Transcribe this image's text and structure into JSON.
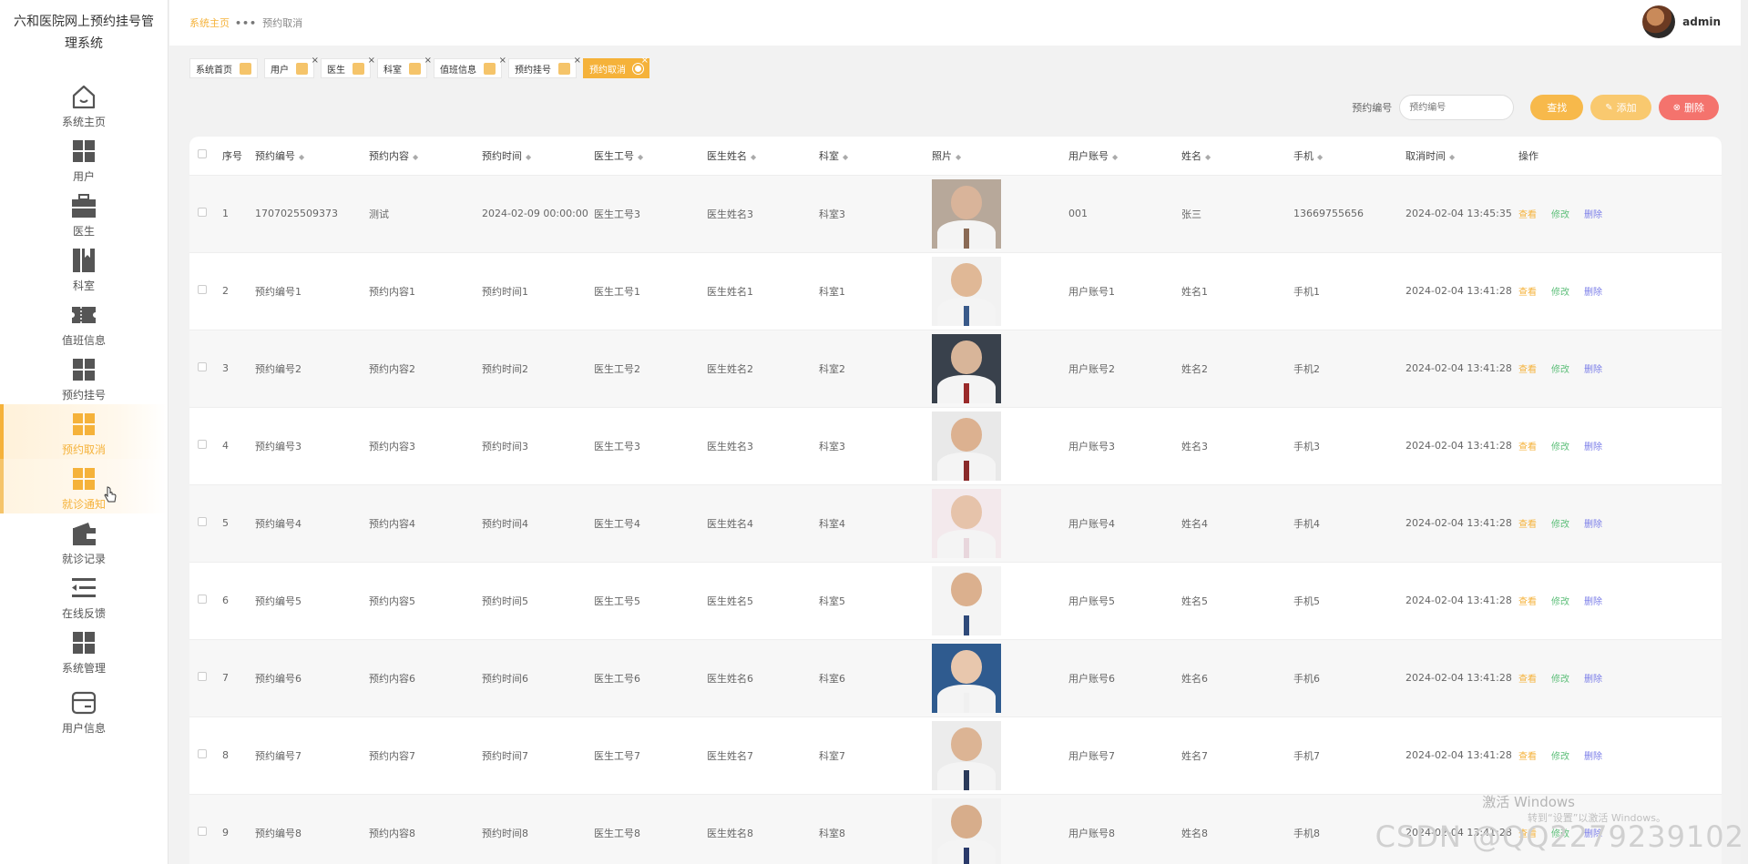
{
  "app": {
    "title": "六和医院网上预约挂号管理系统"
  },
  "sidebar": {
    "items": [
      {
        "label": "系统主页",
        "icon": "home-icon"
      },
      {
        "label": "用户",
        "icon": "grid-icon"
      },
      {
        "label": "医生",
        "icon": "briefcase-icon"
      },
      {
        "label": "科室",
        "icon": "book-icon"
      },
      {
        "label": "值班信息",
        "icon": "ticket-icon"
      },
      {
        "label": "预约挂号",
        "icon": "grid-icon"
      },
      {
        "label": "预约取消",
        "icon": "grid-icon"
      },
      {
        "label": "就诊通知",
        "icon": "grid-icon"
      },
      {
        "label": "就诊记录",
        "icon": "wallet-icon"
      },
      {
        "label": "在线反馈",
        "icon": "list-icon"
      },
      {
        "label": "系统管理",
        "icon": "grid-icon"
      },
      {
        "label": "用户信息",
        "icon": "card-icon"
      }
    ]
  },
  "header": {
    "breadcrumb_home": "系统主页",
    "breadcrumb_sep": "•••",
    "breadcrumb_current": "预约取消",
    "user_name": "admin"
  },
  "tabs": [
    {
      "label": "系统首页"
    },
    {
      "label": "用户"
    },
    {
      "label": "医生"
    },
    {
      "label": "科室"
    },
    {
      "label": "值班信息"
    },
    {
      "label": "预约挂号"
    },
    {
      "label": "预约取消"
    }
  ],
  "search": {
    "label": "预约编号",
    "placeholder": "预约编号",
    "search_btn": "查找",
    "add_btn": "添加",
    "delete_btn": "删除"
  },
  "table": {
    "headers": {
      "index": "序号",
      "appointment_no": "预约编号",
      "content": "预约内容",
      "time": "预约时间",
      "doctor_no": "医生工号",
      "doctor_name": "医生姓名",
      "department": "科室",
      "photo": "照片",
      "account": "用户账号",
      "name": "姓名",
      "phone": "手机",
      "cancel_time": "取消时间",
      "actions": "操作"
    },
    "action_labels": {
      "view": "查看",
      "edit": "修改",
      "delete": "删除"
    },
    "rows": [
      {
        "index": "1",
        "appointment_no": "1707025509373",
        "content": "测试",
        "time": "2024-02-09 00:00:00",
        "doctor_no": "医生工号3",
        "doctor_name": "医生姓名3",
        "department": "科室3",
        "account": "001",
        "name": "张三",
        "phone": "13669755656",
        "cancel_time": "2024-02-04 13:45:35"
      },
      {
        "index": "2",
        "appointment_no": "预约编号1",
        "content": "预约内容1",
        "time": "预约时间1",
        "doctor_no": "医生工号1",
        "doctor_name": "医生姓名1",
        "department": "科室1",
        "account": "用户账号1",
        "name": "姓名1",
        "phone": "手机1",
        "cancel_time": "2024-02-04 13:41:28"
      },
      {
        "index": "3",
        "appointment_no": "预约编号2",
        "content": "预约内容2",
        "time": "预约时间2",
        "doctor_no": "医生工号2",
        "doctor_name": "医生姓名2",
        "department": "科室2",
        "account": "用户账号2",
        "name": "姓名2",
        "phone": "手机2",
        "cancel_time": "2024-02-04 13:41:28"
      },
      {
        "index": "4",
        "appointment_no": "预约编号3",
        "content": "预约内容3",
        "time": "预约时间3",
        "doctor_no": "医生工号3",
        "doctor_name": "医生姓名3",
        "department": "科室3",
        "account": "用户账号3",
        "name": "姓名3",
        "phone": "手机3",
        "cancel_time": "2024-02-04 13:41:28"
      },
      {
        "index": "5",
        "appointment_no": "预约编号4",
        "content": "预约内容4",
        "time": "预约时间4",
        "doctor_no": "医生工号4",
        "doctor_name": "医生姓名4",
        "department": "科室4",
        "account": "用户账号4",
        "name": "姓名4",
        "phone": "手机4",
        "cancel_time": "2024-02-04 13:41:28"
      },
      {
        "index": "6",
        "appointment_no": "预约编号5",
        "content": "预约内容5",
        "time": "预约时间5",
        "doctor_no": "医生工号5",
        "doctor_name": "医生姓名5",
        "department": "科室5",
        "account": "用户账号5",
        "name": "姓名5",
        "phone": "手机5",
        "cancel_time": "2024-02-04 13:41:28"
      },
      {
        "index": "7",
        "appointment_no": "预约编号6",
        "content": "预约内容6",
        "time": "预约时间6",
        "doctor_no": "医生工号6",
        "doctor_name": "医生姓名6",
        "department": "科室6",
        "account": "用户账号6",
        "name": "姓名6",
        "phone": "手机6",
        "cancel_time": "2024-02-04 13:41:28"
      },
      {
        "index": "8",
        "appointment_no": "预约编号7",
        "content": "预约内容7",
        "time": "预约时间7",
        "doctor_no": "医生工号7",
        "doctor_name": "医生姓名7",
        "department": "科室7",
        "account": "用户账号7",
        "name": "姓名7",
        "phone": "手机7",
        "cancel_time": "2024-02-04 13:41:28"
      },
      {
        "index": "9",
        "appointment_no": "预约编号8",
        "content": "预约内容8",
        "time": "预约时间8",
        "doctor_no": "医生工号8",
        "doctor_name": "医生姓名8",
        "department": "科室8",
        "account": "用户账号8",
        "name": "姓名8",
        "phone": "手机8",
        "cancel_time": "2024-02-04 13:41:28"
      }
    ]
  },
  "overlay": {
    "windows_activate": "激活 Windows",
    "windows_activate_sub": "转到“设置”以激活 Windows。",
    "csdn_watermark": "CSDN @QQ2279239102"
  },
  "colors": {
    "accent": "#f5b23a",
    "danger": "#f4736d",
    "edit": "#5ebf7a",
    "delete_link": "#7a7de8"
  }
}
